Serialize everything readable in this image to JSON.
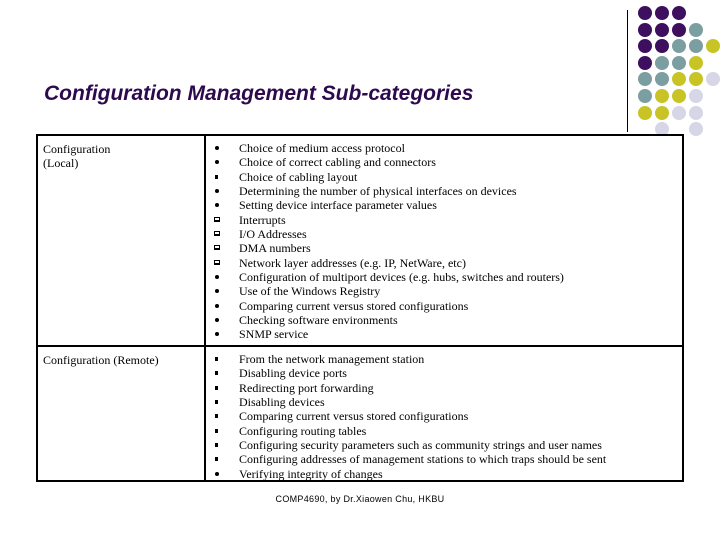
{
  "slide": {
    "title": "Configuration Management Sub-categories",
    "footer": "COMP4690, by Dr.Xiaowen Chu,  HKBU"
  },
  "decoration": {
    "colors": {
      "P": "#3d0f5e",
      "T": "#7b9ea1",
      "Y": "#c8c426",
      "L": "#d6d6e6"
    },
    "grid": [
      [
        "P",
        "P",
        "P",
        "",
        ""
      ],
      [
        "P",
        "P",
        "P",
        "T",
        ""
      ],
      [
        "P",
        "P",
        "T",
        "T",
        "Y"
      ],
      [
        "P",
        "T",
        "T",
        "Y",
        ""
      ],
      [
        "T",
        "T",
        "Y",
        "Y",
        "L"
      ],
      [
        "T",
        "Y",
        "Y",
        "L",
        ""
      ],
      [
        "Y",
        "Y",
        "L",
        "L",
        ""
      ],
      [
        "",
        "L",
        "",
        "L",
        ""
      ]
    ]
  },
  "table": {
    "rows": [
      {
        "category": "Configuration (Local)",
        "category_lines": [
          "Configuration",
          "(Local)"
        ],
        "items": [
          {
            "bullet": "dot",
            "text": "Choice of medium access protocol"
          },
          {
            "bullet": "dot",
            "text": "Choice of correct cabling and connectors"
          },
          {
            "bullet": "smsq",
            "text": "Choice of cabling layout"
          },
          {
            "bullet": "dot",
            "text": "Determining the number of physical interfaces on devices"
          },
          {
            "bullet": "dot",
            "text": "Setting device interface parameter values"
          },
          {
            "bullet": "sq",
            "text": "Interrupts"
          },
          {
            "bullet": "sq",
            "text": "I/O Addresses"
          },
          {
            "bullet": "sq",
            "text": "DMA numbers"
          },
          {
            "bullet": "sq",
            "text": "Network layer addresses (e.g. IP, NetWare, etc)"
          },
          {
            "bullet": "dot",
            "text": "Configuration of multiport devices (e.g. hubs, switches and routers)"
          },
          {
            "bullet": "dot",
            "text": "Use of the Windows Registry"
          },
          {
            "bullet": "dot",
            "text": "Comparing current versus stored configurations"
          },
          {
            "bullet": "dot",
            "text": "Checking software environments"
          },
          {
            "bullet": "dot",
            "text": "SNMP service"
          }
        ]
      },
      {
        "category": "Configuration (Remote)",
        "category_lines": [
          "Configuration (Remote)"
        ],
        "items": [
          {
            "bullet": "smsq",
            "text": "From the network management station"
          },
          {
            "bullet": "smsq",
            "text": "Disabling device ports"
          },
          {
            "bullet": "smsq",
            "text": "Redirecting port forwarding"
          },
          {
            "bullet": "smsq",
            "text": "Disabling devices"
          },
          {
            "bullet": "smsq",
            "text": "Comparing current versus stored configurations"
          },
          {
            "bullet": "smsq",
            "text": "Configuring routing tables"
          },
          {
            "bullet": "smsq",
            "text": "Configuring security parameters such as community strings and user names"
          },
          {
            "bullet": "smsq",
            "text": "Configuring addresses of management stations to which traps should be sent"
          },
          {
            "bullet": "dot",
            "text": "Verifying integrity of changes"
          }
        ]
      }
    ]
  }
}
